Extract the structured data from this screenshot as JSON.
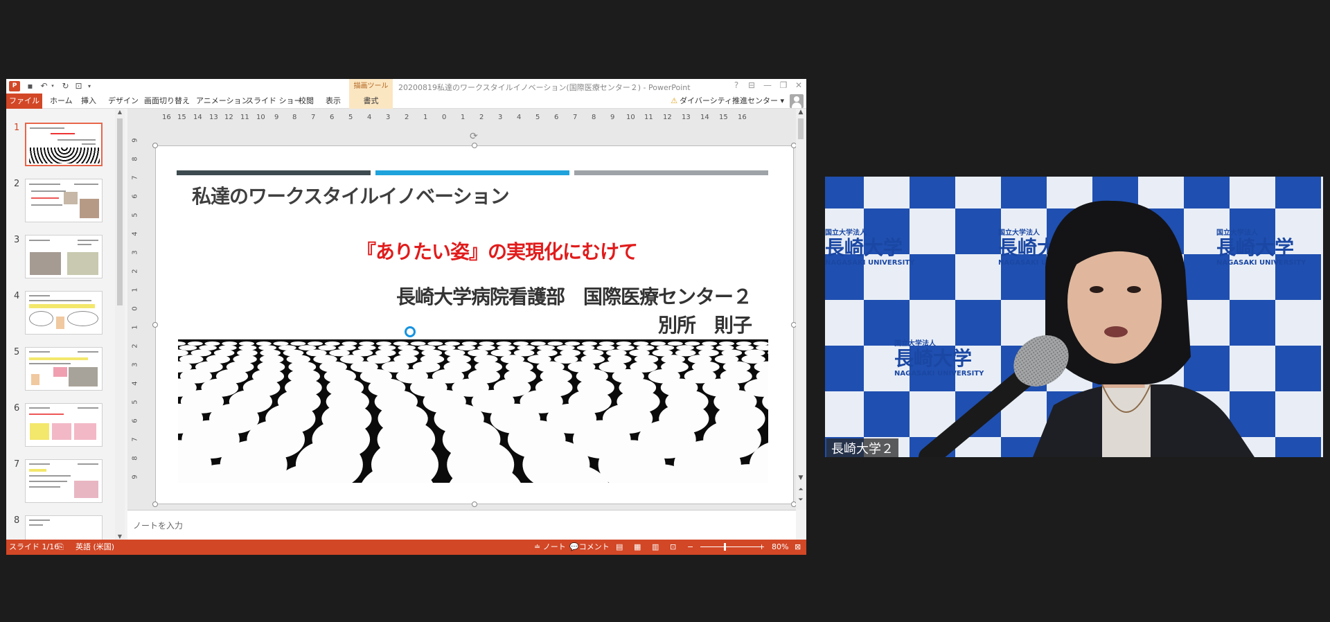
{
  "ppt": {
    "app_icon_text": "P",
    "title": "20200819私達のワークスタイルイノベーション(国際医療センター２) - PowerPoint",
    "drawing_tools": "描画ツール",
    "tabs": [
      "ファイル",
      "ホーム",
      "挿入",
      "デザイン",
      "画面切り替え",
      "アニメーション",
      "スライド ショー",
      "校閲",
      "表示",
      "書式"
    ],
    "account": "ダイバーシティ推進センター",
    "ruler_h": [
      "16",
      "15",
      "14",
      "13",
      "12",
      "11",
      "10",
      "9",
      "8",
      "7",
      "6",
      "5",
      "4",
      "3",
      "2",
      "1",
      "0",
      "1",
      "2",
      "3",
      "4",
      "5",
      "6",
      "7",
      "8",
      "9",
      "10",
      "11",
      "12",
      "13",
      "14",
      "15",
      "16"
    ],
    "ruler_v": [
      "9",
      "8",
      "7",
      "6",
      "5",
      "4",
      "3",
      "2",
      "1",
      "0",
      "1",
      "2",
      "3",
      "4",
      "5",
      "6",
      "7",
      "8",
      "9"
    ],
    "thumbnails": [
      "1",
      "2",
      "3",
      "4",
      "5",
      "6",
      "7",
      "8"
    ],
    "active_slide": 1,
    "slide": {
      "title": "私達のワークスタイルイノベーション",
      "subtitle": "『ありたい姿』の実現化にむけて",
      "org": "長崎大学病院看護部　国際医療センター２",
      "name": "別所　則子",
      "bar_colors": [
        "#3d4b50",
        "#1fa3dc",
        "#9ea3a8"
      ]
    },
    "notes_placeholder": "ノートを入力",
    "status": {
      "slide_info": "スライド 1/16",
      "language": "英語 (米国)",
      "notes_btn": "ノート",
      "comments_btn": "コメント",
      "zoom": "80%"
    }
  },
  "video": {
    "participant_name": "長崎大学２",
    "backdrop": {
      "small": "国立大学法人",
      "big": "長崎大学",
      "english": "NAGASAKI UNIVERSITY",
      "tile_color": "#1f4fb0"
    }
  }
}
